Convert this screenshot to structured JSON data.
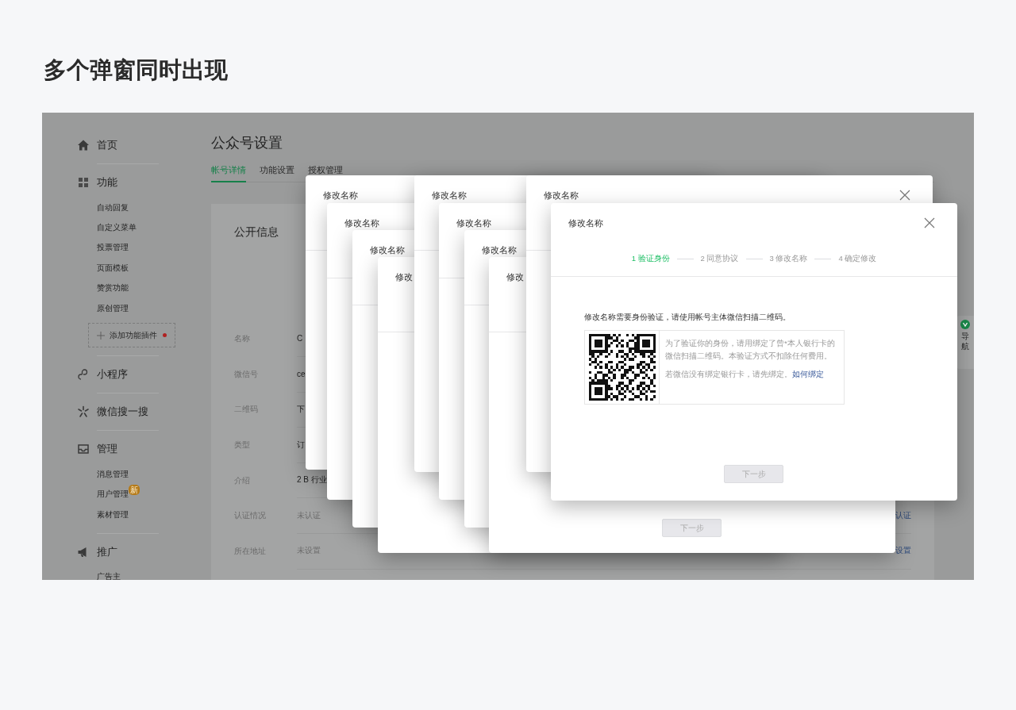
{
  "page_title": "多个弹窗同时出现",
  "screenshot": {
    "sidebar": [
      {
        "label": "首页"
      },
      {
        "label": "功能",
        "items": [
          {
            "label": "自动回复"
          },
          {
            "label": "自定义菜单"
          },
          {
            "label": "投票管理"
          },
          {
            "label": "页面模板"
          },
          {
            "label": "赞赏功能"
          },
          {
            "label": "原创管理"
          }
        ],
        "add_plugin": "添加功能插件"
      },
      {
        "label": "小程序"
      },
      {
        "label": "微信搜一搜"
      },
      {
        "label": "管理",
        "items": [
          {
            "label": "消息管理"
          },
          {
            "label": "用户管理",
            "badge": "新"
          },
          {
            "label": "素材管理"
          }
        ]
      },
      {
        "label": "推广",
        "items": [
          {
            "label": "广告主"
          }
        ]
      }
    ],
    "heading": "公众号设置",
    "tabs": [
      {
        "label": "帐号详情",
        "selected": true
      },
      {
        "label": "功能设置",
        "selected": false
      },
      {
        "label": "授权管理",
        "selected": false
      }
    ],
    "card": {
      "title": "公开信息",
      "rows": [
        {
          "label": "名称",
          "value": "C"
        },
        {
          "label": "微信号",
          "value": "ce"
        },
        {
          "label": "二维码",
          "value": "下"
        },
        {
          "label": "类型",
          "value": "订"
        },
        {
          "label": "介绍",
          "value": "2 B 行业"
        },
        {
          "label": "认证情况",
          "value": "未认证",
          "action": "认证"
        },
        {
          "label": "所在地址",
          "value": "未设置",
          "action": "设置"
        }
      ]
    },
    "float_nav": "导航",
    "dialogs": [
      {
        "title": "修改名称"
      },
      {
        "title": "修改名称"
      },
      {
        "title": "修改名称"
      },
      {
        "title": "修改"
      },
      {
        "title": "修改名称"
      },
      {
        "title": "修改名称"
      },
      {
        "title": "修改名称"
      },
      {
        "title": "修改",
        "button": {
          "label": "下一步",
          "disabled": true
        }
      },
      {
        "title": "修改名称",
        "closable": true
      },
      {
        "title": "修改名称",
        "closable": true,
        "steps": [
          {
            "label": "1 验证身份",
            "selected": true
          },
          {
            "label": "2 同意协议",
            "selected": false
          },
          {
            "label": "3 修改名称",
            "selected": false
          },
          {
            "label": "4 确定修改",
            "selected": false
          }
        ],
        "message": "修改名称需要身份验证，请使用帐号主体微信扫描二维码。",
        "hint": "为了验证你的身份，请用绑定了曾*本人银行卡的微信扫描二维码。本验证方式不扣除任何费用。",
        "bind_hint": "若微信没有绑定银行卡，请先绑定。",
        "bind_link": "如何绑定",
        "button": {
          "label": "下一步",
          "disabled": true
        }
      }
    ]
  }
}
